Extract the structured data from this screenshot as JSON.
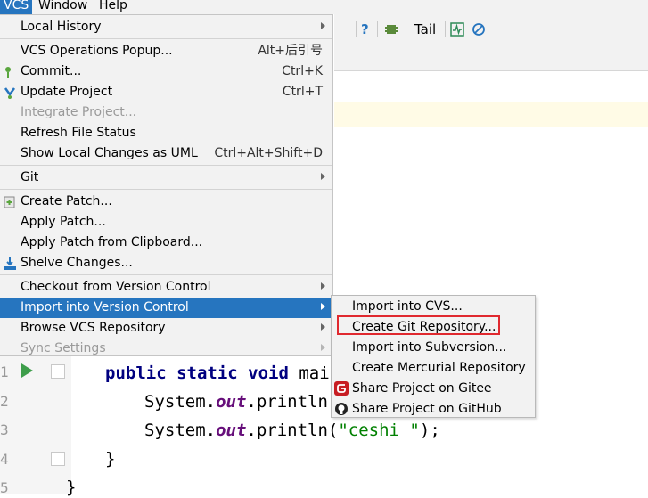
{
  "menubar": {
    "items": [
      {
        "label": "VCS"
      },
      {
        "label": "Window"
      },
      {
        "label": "Help"
      }
    ]
  },
  "toolbar": {
    "help_glyph": "?",
    "tail_label": "Tail"
  },
  "vcs_menu": {
    "items": [
      {
        "label": "Local History",
        "shortcut": "",
        "submenu": true
      },
      {
        "label": "VCS Operations Popup...",
        "shortcut": "Alt+后引号"
      },
      {
        "label": "Commit...",
        "shortcut": "Ctrl+K"
      },
      {
        "label": "Update Project",
        "shortcut": "Ctrl+T"
      },
      {
        "label": "Integrate Project...",
        "shortcut": "",
        "disabled": true
      },
      {
        "label": "Refresh File Status",
        "shortcut": ""
      },
      {
        "label": "Show Local Changes as UML",
        "shortcut": "Ctrl+Alt+Shift+D"
      },
      {
        "label": "Git",
        "shortcut": "",
        "submenu": true
      },
      {
        "label": "Create Patch...",
        "shortcut": ""
      },
      {
        "label": "Apply Patch...",
        "shortcut": ""
      },
      {
        "label": "Apply Patch from Clipboard...",
        "shortcut": ""
      },
      {
        "label": "Shelve Changes...",
        "shortcut": ""
      },
      {
        "label": "Checkout from Version Control",
        "shortcut": "",
        "submenu": true
      },
      {
        "label": "Import into Version Control",
        "shortcut": "",
        "submenu": true,
        "selected": true
      },
      {
        "label": "Browse VCS Repository",
        "shortcut": "",
        "submenu": true
      },
      {
        "label": "Sync Settings",
        "shortcut": "",
        "submenu": true,
        "disabled": true
      }
    ]
  },
  "import_submenu": {
    "items": [
      {
        "label": "Import into CVS..."
      },
      {
        "label": "Create Git Repository..."
      },
      {
        "label": "Import into Subversion..."
      },
      {
        "label": "Create Mercurial Repository"
      },
      {
        "label": "Share Project on Gitee"
      },
      {
        "label": "Share Project on GitHub"
      }
    ]
  },
  "editor": {
    "line_numbers": [
      "1",
      "2",
      "3",
      "4",
      "5"
    ],
    "line1_kw": "public static void",
    "line1_rest": " mai",
    "line2_a": "System.",
    "line2_out": "out",
    "line2_b": ".println(",
    "line3_a": "System.",
    "line3_out": "out",
    "line3_b": ".println(",
    "line3_str": "\"ceshi \"",
    "line3_c": ");",
    "line4": "}",
    "line5": "}"
  },
  "colors": {
    "selection": "#2675bf",
    "highlight_box": "#e0292f",
    "gitee_red": "#c71d23"
  }
}
